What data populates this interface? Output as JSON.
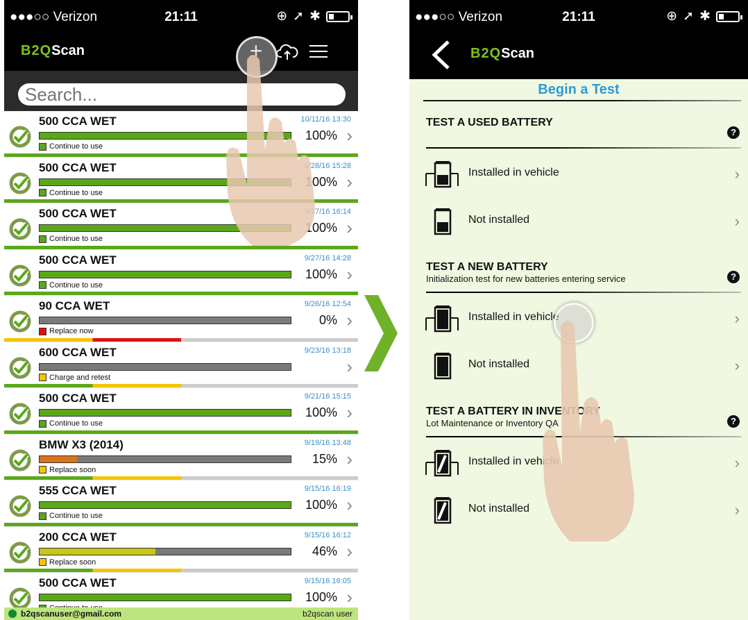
{
  "status": {
    "carrier": "●●●○○ Verizon",
    "time": "21:11"
  },
  "left": {
    "brand": {
      "b2q": "B2Q",
      "scan": "Scan"
    },
    "search_placeholder": "Search...",
    "rows": [
      {
        "title": "500 CCA WET",
        "date": "10/11/16 13:30",
        "pct": "100%",
        "fraction": 1.0,
        "status": "Continue to use",
        "color": "#5aa81a",
        "stripe": "#5aa81a"
      },
      {
        "title": "500 CCA WET",
        "date": "9/28/16 15:28",
        "pct": "100%",
        "fraction": 1.0,
        "status": "Continue to use",
        "color": "#5aa81a",
        "stripe": "#5aa81a"
      },
      {
        "title": "500 CCA WET",
        "date": "9/27/16 16:14",
        "pct": "100%",
        "fraction": 1.0,
        "status": "Continue to use",
        "color": "#5aa81a",
        "stripe": "#5aa81a"
      },
      {
        "title": "500 CCA WET",
        "date": "9/27/16 14:28",
        "pct": "100%",
        "fraction": 1.0,
        "status": "Continue to use",
        "color": "#5aa81a",
        "stripe": "#5aa81a"
      },
      {
        "title": "90 CCA WET",
        "date": "9/26/16 12:54",
        "pct": "0%",
        "fraction": 0.0,
        "status": "Replace now",
        "color": "#e01010",
        "stripe": "red"
      },
      {
        "title": "600 CCA WET",
        "date": "9/23/16 13:18",
        "pct": "",
        "fraction": 0.0,
        "status": "Charge and retest",
        "color": "#f5c400",
        "stripe": "yellow"
      },
      {
        "title": "500 CCA WET",
        "date": "9/21/16 15:15",
        "pct": "100%",
        "fraction": 1.0,
        "status": "Continue to use",
        "color": "#5aa81a",
        "stripe": "#5aa81a"
      },
      {
        "title": "BMW X3 (2014)",
        "date": "9/19/16 13:48",
        "pct": "15%",
        "fraction": 0.15,
        "status": "Replace soon",
        "color": "#f5c400",
        "stripe": "yellow",
        "barcolor": "#d9731c"
      },
      {
        "title": "555 CCA WET",
        "date": "9/15/16 16:19",
        "pct": "100%",
        "fraction": 1.0,
        "status": "Continue to use",
        "color": "#5aa81a",
        "stripe": "#5aa81a"
      },
      {
        "title": "200 CCA WET",
        "date": "9/15/16 16:12",
        "pct": "46%",
        "fraction": 0.46,
        "status": "Replace soon",
        "color": "#f5c400",
        "stripe": "yellow",
        "barcolor": "#c8c41a"
      },
      {
        "title": "500 CCA WET",
        "date": "9/15/16 16:05",
        "pct": "100%",
        "fraction": 1.0,
        "status": "Continue to use",
        "color": "#5aa81a",
        "stripe": "#5aa81a"
      }
    ],
    "footer": {
      "email": "b2qscanuser@gmail.com",
      "user": "b2qscan user"
    }
  },
  "right": {
    "brand": {
      "b2q": "B2Q",
      "scan": "Scan"
    },
    "title": "Begin a Test",
    "groups": [
      {
        "head": "TEST A USED BATTERY",
        "sub": "",
        "options": [
          "Installed in vehicle",
          "Not installed"
        ]
      },
      {
        "head": "TEST A NEW BATTERY",
        "sub": "Initialization test for new batteries entering service",
        "options": [
          "Installed in vehicle",
          "Not installed"
        ]
      },
      {
        "head": "TEST A BATTERY IN INVENTORY",
        "sub": "Lot Maintenance or Inventory QA",
        "options": [
          "Installed in vehicle",
          "Not installed"
        ]
      }
    ],
    "help_glyph": "?"
  }
}
